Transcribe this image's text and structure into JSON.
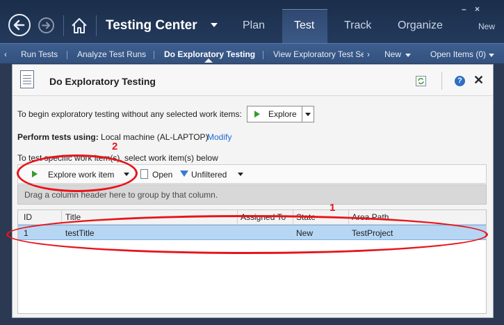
{
  "window_controls": {
    "minimize": "–",
    "close": "×"
  },
  "hub": {
    "app_title": "Testing Center",
    "tabs": [
      {
        "label": "Plan"
      },
      {
        "label": "Test"
      },
      {
        "label": "Track"
      },
      {
        "label": "Organize"
      }
    ],
    "new_label": "New"
  },
  "subnav": {
    "items": [
      {
        "label": "Run Tests"
      },
      {
        "label": "Analyze Test Runs"
      },
      {
        "label": "Do Exploratory Testing"
      },
      {
        "label": "View Exploratory Test Ses"
      }
    ],
    "new_label": "New",
    "open_items_label": "Open Items (0)"
  },
  "panel": {
    "title": "Do Exploratory Testing",
    "help_label": "?",
    "close_label": "✕",
    "intro_text": "To begin exploratory testing without any selected work items:",
    "explore_button": "Explore",
    "perform_label": "Perform tests using:",
    "perform_value": "Local machine (AL-LAPTOP)",
    "modify_link": "Modify",
    "specific_text": "To test specific work item(s), select work item(s) below"
  },
  "toolbar": {
    "explore_work_item": "Explore work item",
    "open": "Open",
    "filter": "Unfiltered"
  },
  "group_hint": "Drag a column header here to group by that column.",
  "grid": {
    "columns": [
      "ID",
      "Title",
      "Assigned To",
      "State",
      "Area Path"
    ],
    "rows": [
      {
        "id": "1",
        "title": "testTitle",
        "assigned_to": "",
        "state": "New",
        "area_path": "TestProject"
      }
    ]
  },
  "annotations": {
    "label_1": "1",
    "label_2": "2"
  },
  "colors": {
    "annotation_red": "#e8141b",
    "selected_row": "#b6d6f4",
    "hub_bg": "#1b2e4b"
  }
}
